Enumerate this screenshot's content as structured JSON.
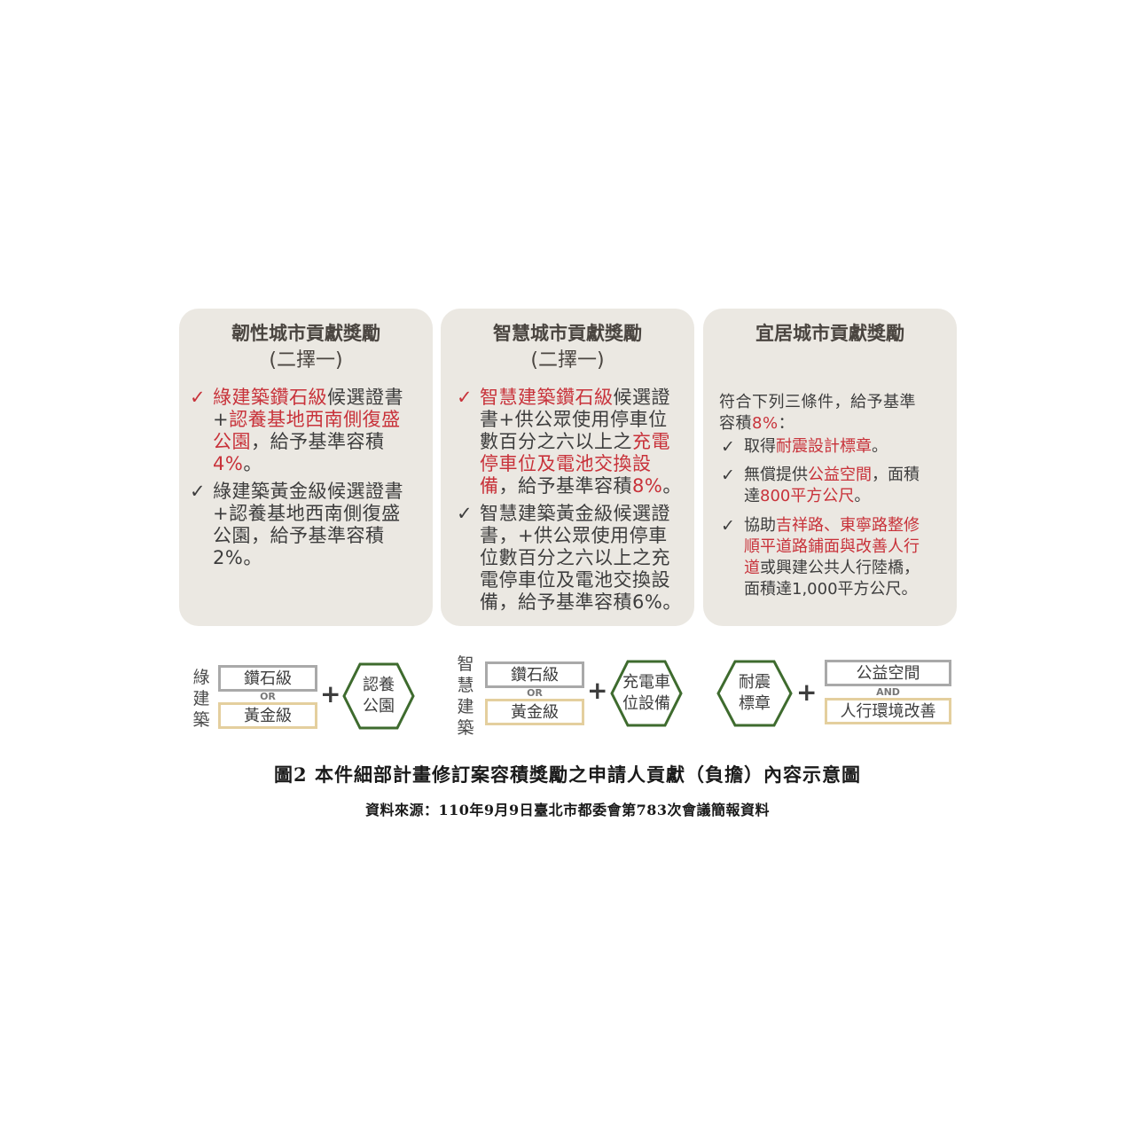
{
  "cards": [
    {
      "title": "韌性城市貢獻獎勵",
      "subtitle": "(二擇一)",
      "items": [
        {
          "lines": [
            [
              {
                "t": "綠建築鑽石級",
                "red": true
              },
              {
                "t": "候選證書",
                "red": false
              }
            ],
            [
              {
                "t": "+",
                "red": false
              },
              {
                "t": "認養基地西南側復盛",
                "red": true
              }
            ],
            [
              {
                "t": "公園",
                "red": true
              },
              {
                "t": "，給予基準容積",
                "red": false
              }
            ],
            [
              {
                "t": "4%",
                "red": true
              },
              {
                "t": "。",
                "red": false
              }
            ]
          ]
        },
        {
          "lines": [
            [
              {
                "t": "綠建築黃金級候選證書",
                "red": false
              }
            ],
            [
              {
                "t": "+認養基地西南側復盛",
                "red": false
              }
            ],
            [
              {
                "t": "公園，給予基準容積",
                "red": false
              }
            ],
            [
              {
                "t": "2%。",
                "red": false
              }
            ]
          ]
        }
      ]
    },
    {
      "title": "智慧城市貢獻獎勵",
      "subtitle": "(二擇一)",
      "items": [
        {
          "lines": [
            [
              {
                "t": "智慧建築鑽石級",
                "red": true
              },
              {
                "t": "候選證",
                "red": false
              }
            ],
            [
              {
                "t": "書+供公眾使用停車位",
                "red": false
              }
            ],
            [
              {
                "t": "數百分之六以上之",
                "red": false
              },
              {
                "t": "充電",
                "red": true
              }
            ],
            [
              {
                "t": "停車位及電池交換設",
                "red": true
              }
            ],
            [
              {
                "t": "備",
                "red": true
              },
              {
                "t": "，給予基準容積",
                "red": false
              },
              {
                "t": "8%",
                "red": true
              },
              {
                "t": "。",
                "red": false
              }
            ]
          ]
        },
        {
          "lines": [
            [
              {
                "t": "智慧建築黃金級候選證",
                "red": false
              }
            ],
            [
              {
                "t": "書，+供公眾使用停車",
                "red": false
              }
            ],
            [
              {
                "t": "位數百分之六以上之充",
                "red": false
              }
            ],
            [
              {
                "t": "電停車位及電池交換設",
                "red": false
              }
            ],
            [
              {
                "t": "備，給予基準容積6%。",
                "red": false
              }
            ]
          ]
        }
      ]
    },
    {
      "title": "宜居城市貢獻獎勵",
      "intro": [
        [
          {
            "t": "符合下列三條件，給予基準",
            "red": false
          }
        ],
        [
          {
            "t": "容積",
            "red": false
          },
          {
            "t": "8%",
            "red": true
          },
          {
            "t": "：",
            "red": false
          }
        ]
      ],
      "items": [
        {
          "lines": [
            [
              {
                "t": "取得",
                "red": false
              },
              {
                "t": "耐震設計標章",
                "red": true
              },
              {
                "t": "。",
                "red": false
              }
            ]
          ]
        },
        {
          "lines": [
            [
              {
                "t": "無償提供",
                "red": false
              },
              {
                "t": "公益空間",
                "red": true
              },
              {
                "t": "，面積",
                "red": false
              }
            ],
            [
              {
                "t": "達",
                "red": false
              },
              {
                "t": "800平方公尺",
                "red": true
              },
              {
                "t": "。",
                "red": false
              }
            ]
          ]
        },
        {
          "lines": [
            [
              {
                "t": "協助",
                "red": false
              },
              {
                "t": "吉祥路、東寧路整修",
                "red": true
              }
            ],
            [
              {
                "t": "順平道路鋪面與改善人行",
                "red": true
              }
            ],
            [
              {
                "t": "道",
                "red": true
              },
              {
                "t": "或興建公共人行陸橋，",
                "red": false
              }
            ],
            [
              {
                "t": "面積達1,000平方公尺。",
                "red": false
              }
            ]
          ]
        }
      ]
    }
  ],
  "bottom": {
    "group1": {
      "label": "綠建築",
      "top": "鑽石級",
      "op": "OR",
      "bottom": "黃金級",
      "plus": "+",
      "hex": [
        "認養",
        "公園"
      ]
    },
    "group2": {
      "label": "智慧建築",
      "top": "鑽石級",
      "op": "OR",
      "bottom": "黃金級",
      "plus": "+",
      "hex": [
        "充電車",
        "位設備"
      ]
    },
    "group3": {
      "hex": [
        "耐震",
        "標章"
      ],
      "plus": "+",
      "top": "公益空間",
      "op": "AND",
      "bottom": "人行環境改善"
    }
  },
  "caption": {
    "title": "圖2 本件細部計畫修訂案容積獎勵之申請人貢獻（負擔）內容示意圖",
    "source": "資料來源：110年9月9日臺北市都委會第783次會議簡報資料"
  },
  "colors": {
    "card_bg": "#ebe8e2",
    "accent_red": "#c8323a",
    "hex_green": "#3e6b2e",
    "box_gray": "#a9a9a9",
    "box_gold": "#e4cf9e"
  }
}
